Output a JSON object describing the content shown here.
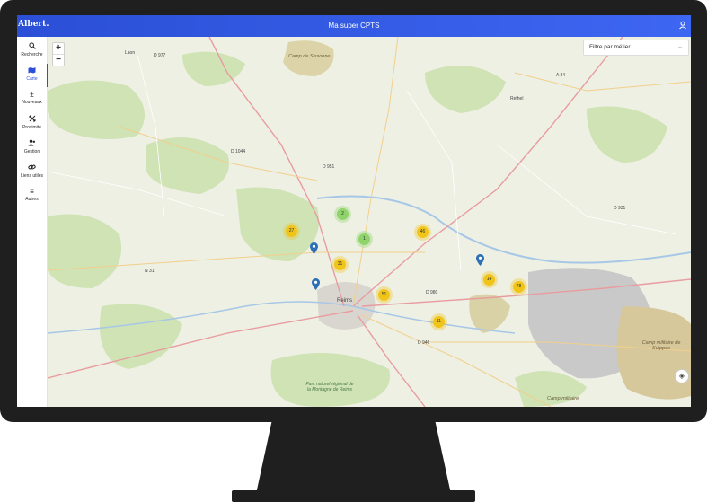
{
  "app": {
    "brand": "Albert.",
    "title": "Ma super CPTS"
  },
  "icons": {
    "user": "user-icon",
    "search": "search-icon",
    "map": "map-icon",
    "new": "plus-minus-icon",
    "proximity": "arrows-icon",
    "manage": "users-icon",
    "links": "link-icon",
    "others": "menu-icon",
    "locate": "locate-icon"
  },
  "sidebar": {
    "items": [
      {
        "label": "Recherche"
      },
      {
        "label": "Carte"
      },
      {
        "label": "Nouveaux"
      },
      {
        "label": "Proximité"
      },
      {
        "label": "Gestion"
      },
      {
        "label": "Liens utiles"
      },
      {
        "label": "Autres"
      }
    ]
  },
  "map": {
    "zoom_in": "+",
    "zoom_out": "−",
    "filter_placeholder": "Filtre par métier",
    "clusters": [
      "2",
      "27",
      "1",
      "46",
      "31",
      "51",
      "14",
      "78",
      "11"
    ],
    "places": {
      "city": "Reims",
      "rethel": "Rethel",
      "laon": "Laon",
      "camp_top": "Camp de Sissonne",
      "parc": "Parc naturel régional de la Montagne de Reims",
      "camp_right": "Camp militaire de Suippes",
      "camp_bottom": "Camp militaire"
    },
    "roads": [
      "D 977",
      "D 1044",
      "N 31",
      "D 951",
      "D 980",
      "A 34",
      "D 946",
      "D 931"
    ]
  },
  "colors": {
    "topbar": "#2b4fd6",
    "active": "#2b4fd6",
    "cluster_yellow": "#f0c419",
    "cluster_green": "#8fd36b",
    "pin": "#2c6fb7"
  }
}
